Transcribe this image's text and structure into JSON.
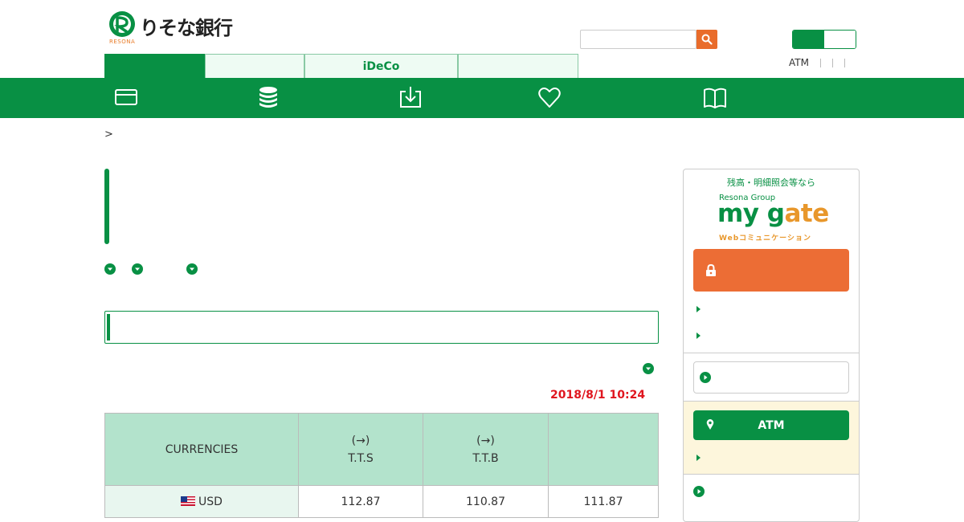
{
  "header": {
    "logo_text": "りそな銀行",
    "logo_sub": "RESONA",
    "search_placeholder": "",
    "util_links": [
      "ATM",
      "",
      "",
      ""
    ]
  },
  "tabs": [
    {
      "label": "",
      "active": true
    },
    {
      "label": "",
      "active": false
    },
    {
      "label": "iDeCo",
      "active": false
    },
    {
      "label": "",
      "active": false
    }
  ],
  "nav_icons": [
    "card-icon",
    "coins-stack-icon",
    "download-tray-icon",
    "heart-icon",
    "book-icon"
  ],
  "breadcrumb": {
    "separator": ">"
  },
  "rates": {
    "timestamp": "2018/8/1 10:24",
    "columns": {
      "currencies": "CURRENCIES",
      "tts_arrow": "(→)",
      "tts": "T.T.S",
      "ttb_arrow": "(→)",
      "ttb": "T.T.B",
      "mid": ""
    },
    "rows": [
      {
        "currency": "USD",
        "tts": "112.87",
        "ttb": "110.87",
        "mid": "111.87"
      }
    ]
  },
  "sidebar": {
    "tagline": "残高・明細照会等なら",
    "group": "Resona Group",
    "brand_a": "my g",
    "brand_b": "ate",
    "brand_sub": "Webコミュニケーション",
    "atm_label": "ATM"
  },
  "colors": {
    "brand_green": "#089044",
    "accent_orange": "#ec6d35",
    "date_red": "#e0161f",
    "table_header": "#b3e3cc"
  }
}
